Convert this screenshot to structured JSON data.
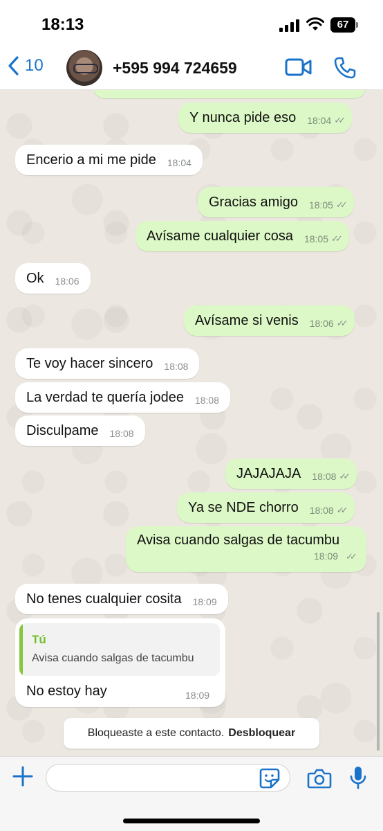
{
  "status_bar": {
    "time": "18:13",
    "battery": "67"
  },
  "header": {
    "back_count": "10",
    "contact_name": "+595 994 724659"
  },
  "messages": [
    {
      "text": "Y nunca pide eso",
      "time": "18:04"
    },
    {
      "text": "Encerio a mi me pide",
      "time": "18:04"
    },
    {
      "text": "Gracias amigo",
      "time": "18:05"
    },
    {
      "text": "Avísame cualquier cosa",
      "time": "18:05"
    },
    {
      "text": "Ok",
      "time": "18:06"
    },
    {
      "text": "Avísame si venis",
      "time": "18:06"
    },
    {
      "text": "Te voy hacer sincero",
      "time": "18:08"
    },
    {
      "text": "La verdad te quería jodee",
      "time": "18:08"
    },
    {
      "text": "Disculpame",
      "time": "18:08"
    },
    {
      "text": "JAJAJAJA",
      "time": "18:08"
    },
    {
      "text": "Ya se NDE chorro",
      "time": "18:08"
    },
    {
      "text": "Avisa cuando salgas de tacumbu",
      "time": "18:09"
    },
    {
      "text": "No tenes cualquier cosita",
      "time": "18:09"
    },
    {
      "text": "No estoy hay",
      "time": "18:09",
      "reply_to": {
        "author": "Tú",
        "text": "Avisa cuando salgas de tacumbu"
      }
    }
  ],
  "partial_top_time": "18:04",
  "blocked_banner": {
    "text": "Bloqueaste a este contacto.",
    "link": "Desbloquear"
  },
  "composer": {
    "placeholder": ""
  },
  "colors": {
    "outgoing_bubble": "#dcf8c6",
    "incoming_bubble": "#ffffff",
    "accent_blue": "#1a73c9",
    "reply_green": "#6fbf2c"
  }
}
